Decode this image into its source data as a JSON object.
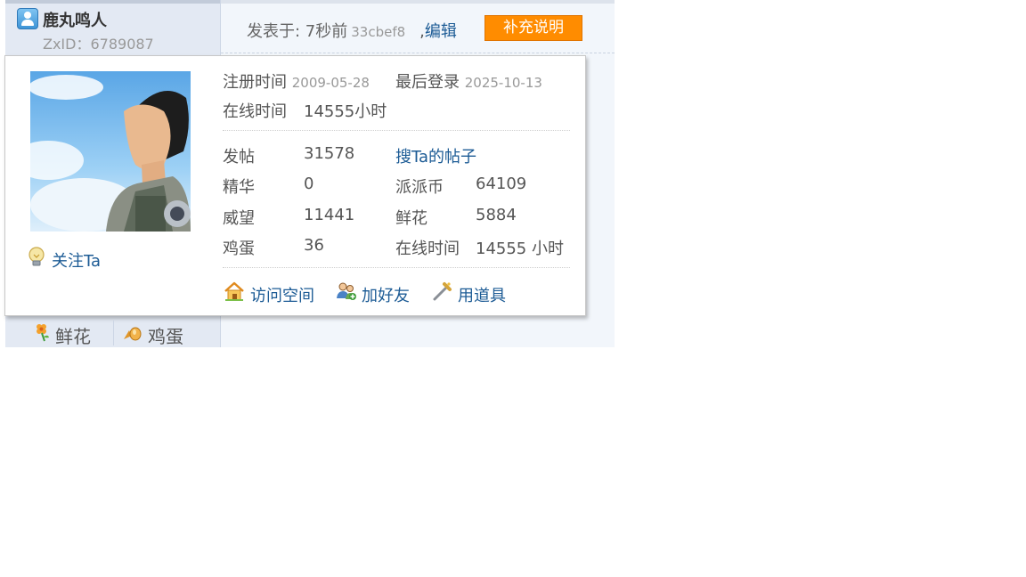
{
  "user": {
    "name": "鹿丸鸣人",
    "zxid": "ZxID：6789087"
  },
  "post": {
    "posted_prefix": "发表于: 7秒前",
    "hash": "33cbef8",
    "comma": ",",
    "edit_label": "编辑",
    "supplement_label": "补充说明"
  },
  "card": {
    "reg_label": "注册时间",
    "reg_date": "2009-05-28",
    "last_label": "最后登录",
    "last_date": "2025-10-13",
    "online_label": "在线时间",
    "online_value": "14555小时",
    "follow_label": "关注Ta",
    "stats": {
      "posts_label": "发帖",
      "posts_value": "31578",
      "search_link": "搜Ta的帖子",
      "digest_label": "精华",
      "digest_value": "0",
      "coins_label": "派派币",
      "coins_value": "64109",
      "prestige_label": "威望",
      "prestige_value": "11441",
      "flowers_label": "鲜花",
      "flowers_value": "5884",
      "eggs_label": "鸡蛋",
      "eggs_value": "36",
      "online2_label": "在线时间",
      "online2_value": "14555 小时"
    },
    "actions": {
      "visit_space": "访问空间",
      "add_friend": "加好友",
      "use_item": "用道具"
    }
  },
  "bottom": {
    "flower_label": "鲜花",
    "egg_label": "鸡蛋"
  },
  "colors": {
    "link": "#1c5b95",
    "accent_button": "#ff8c00",
    "sidebar_bg": "#e3e9f3",
    "post_bg": "#f2f6fb"
  },
  "icons": [
    "user-icon",
    "avatar-image",
    "lightbulb-icon",
    "house-icon",
    "friends-icon",
    "wand-icon",
    "flower-icon",
    "egg-icon"
  ]
}
